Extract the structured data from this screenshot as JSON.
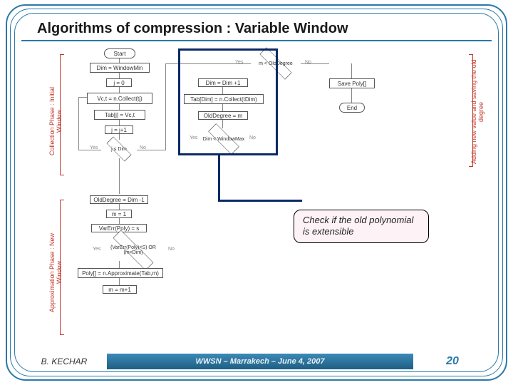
{
  "title": "Algorithms of compression : Variable Window",
  "side_labels": {
    "collection": "Collection Phase : Initial Window",
    "approximation": "Approximation Phase : New Window",
    "right": "Adding new value and saving the old degree"
  },
  "nodes": {
    "start": "Start",
    "dim_wmin": "Dim = WindowMin",
    "j0": "j = 0",
    "vc": "Vc,t = n.Collect(tj)",
    "tabj": "Tab[j] = Vc,t",
    "jincr": "j = j+1",
    "jdim": "j ≤ Dim",
    "old_degree": "OldDegree = Dim -1",
    "m1": "m = 1",
    "varf": "VarErr(Poly) = s",
    "cond": "(VarErr(Poly)<S) OR (m<Dim)",
    "approx": "Poly[] = n.Approximate(Tab,m)",
    "mincr": "m = m+1",
    "mold": "m < OldDegree",
    "dimincr": "Dim = Dim +1",
    "tabdim": "Tab[Dim] = n.Collect(tDim)",
    "olddeg_m": "OldDegree = m",
    "dim_wmax": "Dim < WindowMax",
    "save": "Save Poly[]",
    "end": "End"
  },
  "edge_labels": {
    "yes1": "Yes",
    "no1": "No",
    "yes2": "Yes",
    "no2": "No",
    "yes3": "Yes",
    "no3": "No"
  },
  "callout": "Check if the old polynomial is extensible",
  "footer": {
    "author": "B. KECHAR",
    "center": "WWSN – Marrakech – June 4, 2007",
    "page": "20"
  }
}
